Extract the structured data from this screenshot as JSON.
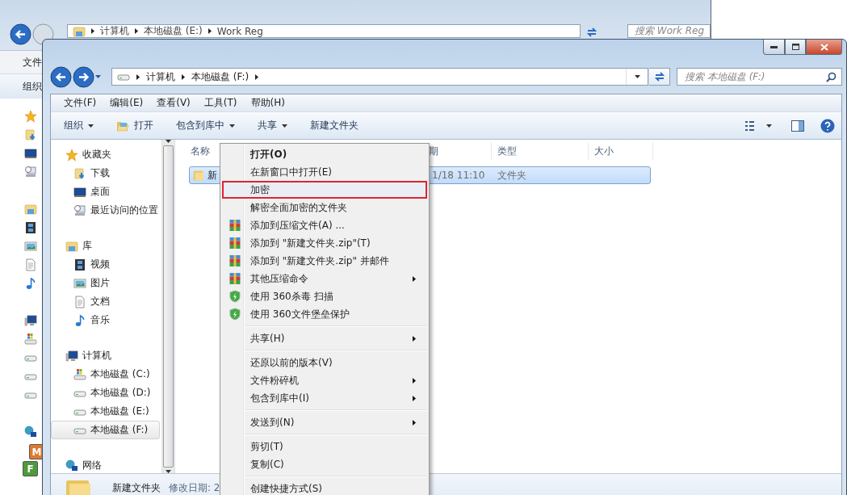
{
  "back_window": {
    "address": {
      "segments": [
        "计算机",
        "本地磁盘 (E:)",
        "Work Reg"
      ]
    },
    "search": {
      "placeholder": "搜索 Work Reg"
    },
    "menu": [
      "文件"
    ],
    "toolbar": [
      "组织"
    ],
    "app_tiles": [
      {
        "letter": "M",
        "color": "#e07a2c"
      },
      {
        "letter": "F",
        "color": "#4e9a3c"
      }
    ]
  },
  "window": {
    "address": {
      "segments": [
        "计算机",
        "本地磁盘 (F:)"
      ]
    },
    "search": {
      "placeholder": "搜索 本地磁盘 (F:)"
    },
    "menu": [
      "文件(F)",
      "编辑(E)",
      "查看(V)",
      "工具(T)",
      "帮助(H)"
    ],
    "toolbar": [
      {
        "label": "组织",
        "dropdown": true
      },
      {
        "label": "打开",
        "dropdown": false
      },
      {
        "label": "包含到库中",
        "dropdown": true
      },
      {
        "label": "共享",
        "dropdown": true
      },
      {
        "label": "新建文件夹",
        "dropdown": false
      }
    ],
    "nav_pane": [
      {
        "label": "收藏夹",
        "selected": false,
        "children": [
          {
            "label": "下载",
            "selected": false
          },
          {
            "label": "桌面",
            "selected": false
          },
          {
            "label": "最近访问的位置",
            "selected": false
          }
        ]
      },
      {
        "label": "库",
        "selected": false,
        "children": [
          {
            "label": "视频",
            "selected": false
          },
          {
            "label": "图片",
            "selected": false
          },
          {
            "label": "文档",
            "selected": false
          },
          {
            "label": "音乐",
            "selected": false
          }
        ]
      },
      {
        "label": "计算机",
        "selected": false,
        "children": [
          {
            "label": "本地磁盘 (C:)",
            "selected": false
          },
          {
            "label": "本地磁盘 (D:)",
            "selected": false
          },
          {
            "label": "本地磁盘 (E:)",
            "selected": false
          },
          {
            "label": "本地磁盘 (F:)",
            "selected": true
          }
        ]
      },
      {
        "label": "网络",
        "selected": false
      }
    ],
    "columns": [
      "名称",
      "期",
      "类型",
      "大小"
    ],
    "rows": [
      {
        "name": "新",
        "date": "1/18 11:10",
        "type": "文件夹",
        "selected": true
      }
    ],
    "status_bar": {
      "name": "新建文件夹",
      "detail": "修改日期: 2"
    }
  },
  "context_menu": {
    "groups": [
      [
        {
          "label": "打开(O)",
          "default": true,
          "kind": "plain",
          "submenu": false,
          "marked": false
        },
        {
          "label": "在新窗口中打开(E)",
          "default": false,
          "kind": "plain",
          "submenu": false,
          "marked": false
        },
        {
          "label": "加密",
          "default": false,
          "kind": "plain",
          "submenu": false,
          "marked": true
        },
        {
          "label": "解密全面加密的文件夹",
          "default": false,
          "kind": "plain",
          "submenu": false,
          "marked": false
        },
        {
          "label": "添加到压缩文件(A) ...",
          "default": false,
          "kind": "archive",
          "submenu": false,
          "marked": false
        },
        {
          "label": "添加到 \"新建文件夹.zip\"(T)",
          "default": false,
          "kind": "archive",
          "submenu": false,
          "marked": false
        },
        {
          "label": "添加到 \"新建文件夹.zip\" 并邮件",
          "default": false,
          "kind": "archive",
          "submenu": false,
          "marked": false
        },
        {
          "label": "其他压缩命令",
          "default": false,
          "kind": "archive",
          "submenu": true,
          "marked": false
        },
        {
          "label": "使用 360杀毒 扫描",
          "default": false,
          "kind": "shield",
          "submenu": false,
          "marked": false
        },
        {
          "label": "使用 360文件堡垒保护",
          "default": false,
          "kind": "shield",
          "submenu": false,
          "marked": false
        }
      ],
      [
        {
          "label": "共享(H)",
          "default": false,
          "kind": "plain",
          "submenu": true,
          "marked": false
        }
      ],
      [
        {
          "label": "还原以前的版本(V)",
          "default": false,
          "kind": "plain",
          "submenu": false,
          "marked": false
        },
        {
          "label": "文件粉碎机",
          "default": false,
          "kind": "plain",
          "submenu": true,
          "marked": false
        },
        {
          "label": "包含到库中(I)",
          "default": false,
          "kind": "plain",
          "submenu": true,
          "marked": false
        }
      ],
      [
        {
          "label": "发送到(N)",
          "default": false,
          "kind": "plain",
          "submenu": true,
          "marked": false
        }
      ],
      [
        {
          "label": "剪切(T)",
          "default": false,
          "kind": "plain",
          "submenu": false,
          "marked": false
        },
        {
          "label": "复制(C)",
          "default": false,
          "kind": "plain",
          "submenu": false,
          "marked": false
        }
      ],
      [
        {
          "label": "创建快捷方式(S)",
          "default": false,
          "kind": "plain",
          "submenu": false,
          "marked": false
        }
      ]
    ]
  }
}
